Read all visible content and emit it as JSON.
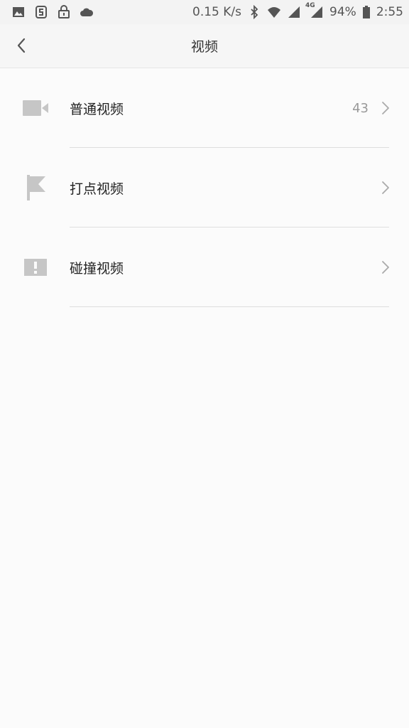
{
  "status_bar": {
    "net_speed": "0.15 K/s",
    "network_type": "4G",
    "battery": "94%",
    "time": "2:55",
    "icons": [
      "image-icon",
      "app-icon",
      "lock-icon",
      "cloud-icon",
      "bluetooth-icon",
      "wifi-icon",
      "signal-icon",
      "signal-4g-icon",
      "battery-icon"
    ]
  },
  "header": {
    "title": "视频",
    "back_icon": "back-arrow-icon"
  },
  "list": {
    "items": [
      {
        "label": "普通视频",
        "count": "43",
        "icon": "video-camera-icon"
      },
      {
        "label": "打点视频",
        "count": "",
        "icon": "flag-icon"
      },
      {
        "label": "碰撞视频",
        "count": "",
        "icon": "alert-icon"
      }
    ]
  },
  "colors": {
    "icon_gray": "#c6c6c6",
    "divider": "#dedede",
    "background": "#fbfbfb",
    "text": "#222222",
    "count_text": "#999999"
  }
}
